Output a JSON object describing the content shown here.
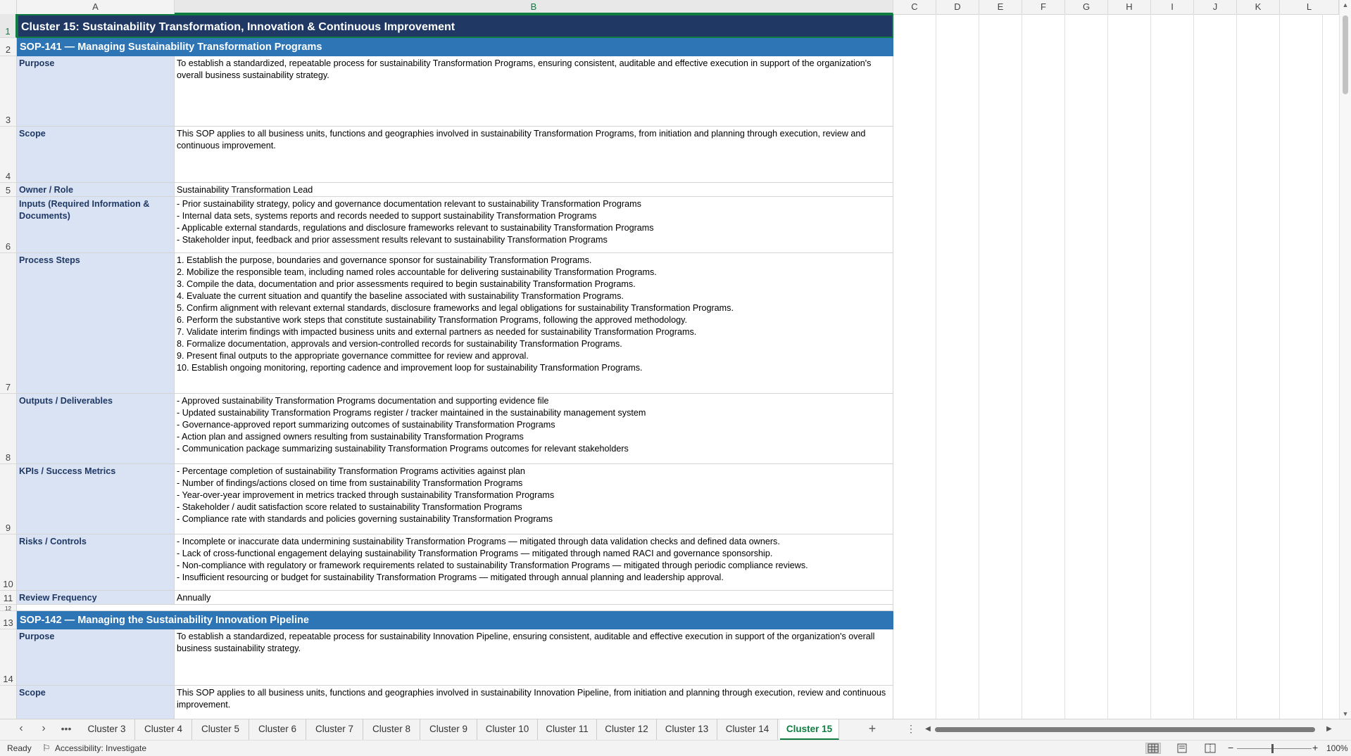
{
  "columns": [
    "A",
    "B",
    "C",
    "D",
    "E",
    "F",
    "G",
    "H",
    "I",
    "J",
    "K",
    "L"
  ],
  "cluster_title": "Cluster 15: Sustainability Transformation, Innovation & Continuous Improvement",
  "sop141": {
    "header": "SOP-141  —  Managing Sustainability Transformation Programs",
    "rows": [
      {
        "label": "Purpose",
        "value": "To establish a standardized, repeatable process for sustainability Transformation Programs, ensuring consistent, auditable and effective execution in support of the organization's overall business sustainability strategy."
      },
      {
        "label": "Scope",
        "value": "This SOP applies to all business units, functions and geographies involved in sustainability Transformation Programs, from initiation and planning through execution, review and continuous improvement."
      },
      {
        "label": "Owner / Role",
        "value": "Sustainability Transformation Lead"
      },
      {
        "label": "Inputs (Required Information & Documents)",
        "value": "- Prior sustainability strategy, policy and governance documentation relevant to sustainability Transformation Programs\n- Internal data sets, systems reports and records needed to support sustainability Transformation Programs\n- Applicable external standards, regulations and disclosure frameworks relevant to sustainability Transformation Programs\n- Stakeholder input, feedback and prior assessment results relevant to sustainability Transformation Programs"
      },
      {
        "label": "Process Steps",
        "value": "1. Establish the purpose, boundaries and governance sponsor for sustainability Transformation Programs.\n2. Mobilize the responsible team, including named roles accountable for delivering sustainability Transformation Programs.\n3. Compile the data, documentation and prior assessments required to begin sustainability Transformation Programs.\n4. Evaluate the current situation and quantify the baseline associated with sustainability Transformation Programs.\n5. Confirm alignment with relevant external standards, disclosure frameworks and legal obligations for sustainability Transformation Programs.\n6. Perform the substantive work steps that constitute sustainability Transformation Programs, following the approved methodology.\n7. Validate interim findings with impacted business units and external partners as needed for sustainability Transformation Programs.\n8. Formalize documentation, approvals and version-controlled records for sustainability Transformation Programs.\n9. Present final outputs to the appropriate governance committee for review and approval.\n10. Establish ongoing monitoring, reporting cadence and improvement loop for sustainability Transformation Programs."
      },
      {
        "label": "Outputs / Deliverables",
        "value": "- Approved sustainability Transformation Programs documentation and supporting evidence file\n- Updated sustainability Transformation Programs register / tracker maintained in the sustainability management system\n- Governance-approved report summarizing outcomes of sustainability Transformation Programs\n- Action plan and assigned owners resulting from sustainability Transformation Programs\n- Communication package summarizing sustainability Transformation Programs outcomes for relevant stakeholders"
      },
      {
        "label": "KPIs / Success Metrics",
        "value": "- Percentage completion of sustainability Transformation Programs activities against plan\n- Number of findings/actions closed on time from sustainability Transformation Programs\n- Year-over-year improvement in metrics tracked through sustainability Transformation Programs\n- Stakeholder / audit satisfaction score related to sustainability Transformation Programs\n- Compliance rate with standards and policies governing sustainability Transformation Programs"
      },
      {
        "label": "Risks / Controls",
        "value": "- Incomplete or inaccurate data undermining sustainability Transformation Programs — mitigated through data validation checks and defined data owners.\n- Lack of cross-functional engagement delaying sustainability Transformation Programs — mitigated through named RACI and governance sponsorship.\n- Non-compliance with regulatory or framework requirements related to sustainability Transformation Programs — mitigated through periodic compliance reviews.\n- Insufficient resourcing or budget for sustainability Transformation Programs — mitigated through annual planning and leadership approval."
      },
      {
        "label": "Review Frequency",
        "value": "Annually"
      }
    ]
  },
  "sop142": {
    "header": "SOP-142  —  Managing the Sustainability Innovation Pipeline",
    "rows": [
      {
        "label": "Purpose",
        "value": "To establish a standardized, repeatable process for sustainability Innovation Pipeline, ensuring consistent, auditable and effective execution in support of the organization's overall business sustainability strategy."
      },
      {
        "label": "Scope",
        "value": "This SOP applies to all business units, functions and geographies involved in sustainability Innovation Pipeline, from initiation and planning through execution, review and continuous improvement."
      }
    ]
  },
  "sheet_tabs": [
    "Cluster 3",
    "Cluster 4",
    "Cluster 5",
    "Cluster 6",
    "Cluster 7",
    "Cluster 8",
    "Cluster 9",
    "Cluster 10",
    "Cluster 11",
    "Cluster 12",
    "Cluster 13",
    "Cluster 14",
    "Cluster 15"
  ],
  "active_tab": "Cluster 15",
  "status": {
    "ready": "Ready",
    "accessibility": "Accessibility: Investigate",
    "zoom": "100%"
  },
  "colors": {
    "title_bg": "#1f3864",
    "sop_header_bg": "#2e75b6",
    "label_bg": "#dae3f3",
    "label_text": "#1f3864",
    "excel_green": "#107c41"
  }
}
